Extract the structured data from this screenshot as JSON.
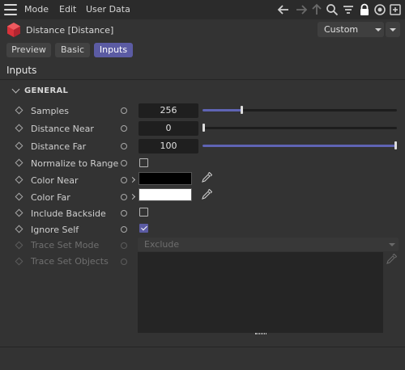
{
  "menubar": {
    "items": [
      "Mode",
      "Edit",
      "User Data"
    ],
    "icons": [
      "back-arrow-icon",
      "forward-arrow-icon",
      "up-arrow-icon",
      "search-icon",
      "filter-icon",
      "lock-icon",
      "target-icon",
      "add-window-icon"
    ]
  },
  "header": {
    "object_title": "Distance [Distance]",
    "preset_value": "Custom"
  },
  "tabs": [
    {
      "label": "Preview",
      "active": false
    },
    {
      "label": "Basic",
      "active": false
    },
    {
      "label": "Inputs",
      "active": true
    }
  ],
  "section_title": "Inputs",
  "group": {
    "title": "GENERAL"
  },
  "params": {
    "samples": {
      "label": "Samples",
      "value": "256",
      "slider_fraction": 0.2
    },
    "distance_near": {
      "label": "Distance Near",
      "value": "0",
      "slider_fraction": 0.0
    },
    "distance_far": {
      "label": "Distance Far",
      "value": "100",
      "slider_fraction": 1.0
    },
    "normalize": {
      "label": "Normalize to Range",
      "checked": false
    },
    "color_near": {
      "label": "Color Near",
      "color": "#000000"
    },
    "color_far": {
      "label": "Color Far",
      "color": "#ffffff"
    },
    "include_backside": {
      "label": "Include Backside",
      "checked": false
    },
    "ignore_self": {
      "label": "Ignore Self",
      "checked": true
    },
    "trace_set_mode": {
      "label": "Trace Set Mode",
      "value": "Exclude",
      "disabled": true
    },
    "trace_set_objects": {
      "label": "Trace Set Objects",
      "disabled": true
    }
  },
  "colors": {
    "accent": "#5b5ba3",
    "slider_fill": "#5f64b4",
    "background": "#333333"
  }
}
